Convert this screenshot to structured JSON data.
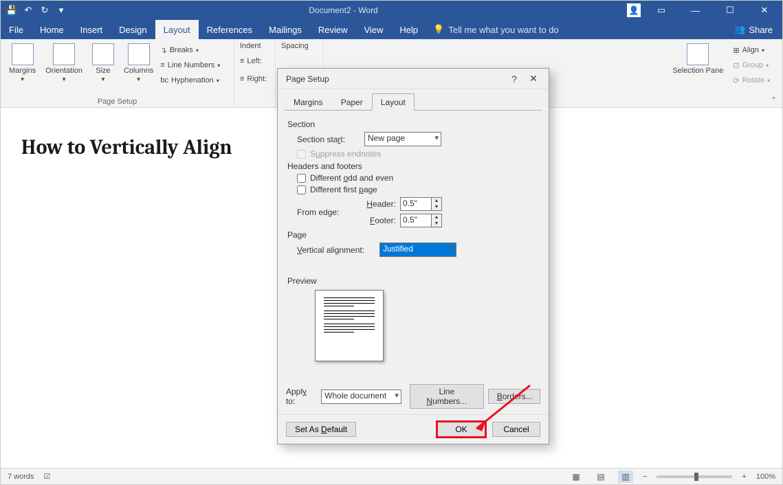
{
  "titlebar": {
    "title": "Document2 - Word",
    "user_hidden": ""
  },
  "menu": {
    "tabs": [
      "File",
      "Home",
      "Insert",
      "Design",
      "Layout",
      "References",
      "Mailings",
      "Review",
      "View",
      "Help"
    ],
    "tell_me": "Tell me what you want to do",
    "share": "Share"
  },
  "ribbon": {
    "margins": "Margins",
    "orientation": "Orientation",
    "size": "Size",
    "columns": "Columns",
    "breaks": "Breaks",
    "line_numbers": "Line Numbers",
    "hyphenation": "Hyphenation",
    "page_setup_group": "Page Setup",
    "indent_group": "Indent",
    "left": "Left:",
    "right": "Right:",
    "spacing_group": "Spacing",
    "selection_pane": "Selection Pane",
    "align": "Align",
    "group": "Group",
    "rotate": "Rotate"
  },
  "document": {
    "heading": "How to Vertically Align"
  },
  "statusbar": {
    "words": "7 words",
    "zoom": "100%"
  },
  "dialog": {
    "title": "Page Setup",
    "tabs": {
      "margins": "Margins",
      "paper": "Paper",
      "layout": "Layout"
    },
    "section": "Section",
    "section_start_label": "Section start:",
    "section_start_value": "New page",
    "suppress": "Suppress endnotes",
    "headers_footers": "Headers and footers",
    "diff_odd_even": "Different odd and even",
    "diff_first": "Different first page",
    "from_edge": "From edge:",
    "header_label": "Header:",
    "footer_label": "Footer:",
    "header_val": "0.5\"",
    "footer_val": "0.5\"",
    "page": "Page",
    "valign_label": "Vertical alignment:",
    "valign_value": "Justified",
    "preview": "Preview",
    "apply_to_label": "Apply to:",
    "apply_to_value": "Whole document",
    "line_numbers_btn": "Line Numbers...",
    "borders_btn": "Borders...",
    "set_default": "Set As Default",
    "ok": "OK",
    "cancel": "Cancel"
  }
}
